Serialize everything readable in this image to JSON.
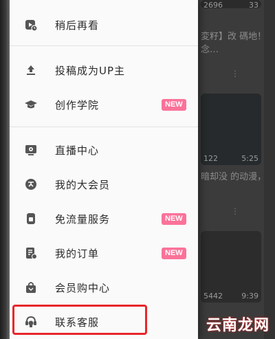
{
  "drawer": {
    "items": [
      {
        "label": "稍后再看",
        "icon": "play-later-icon",
        "badge": null
      },
      {
        "label": "投稿成为UP主",
        "icon": "upload-icon",
        "badge": null
      },
      {
        "label": "创作学院",
        "icon": "graduation-cap-icon",
        "badge": "NEW"
      },
      {
        "label": "直播中心",
        "icon": "live-tv-icon",
        "badge": null
      },
      {
        "label": "我的大会员",
        "icon": "vip-icon",
        "badge": null
      },
      {
        "label": "免流量服务",
        "icon": "sim-card-icon",
        "badge": "NEW"
      },
      {
        "label": "我的订单",
        "icon": "order-icon",
        "badge": "NEW"
      },
      {
        "label": "会员购中心",
        "icon": "shopping-bag-icon",
        "badge": null
      },
      {
        "label": "联系客服",
        "icon": "customer-service-icon",
        "badge": null
      }
    ],
    "highlighted_item": "联系客服",
    "accent_color": "#fb7299",
    "highlight_color": "#e8262b"
  },
  "background": {
    "video1": {
      "views": "2696",
      "duration": "33",
      "title": "変籽】改 碼地！念…"
    },
    "video2": {
      "views": "122",
      "duration": "5:25",
      "title": "暗却没 的动漫，"
    },
    "video3": {
      "views": "5442",
      "duration": "9:39"
    },
    "more_symbol": "⋮"
  },
  "watermark": "云南龙网"
}
